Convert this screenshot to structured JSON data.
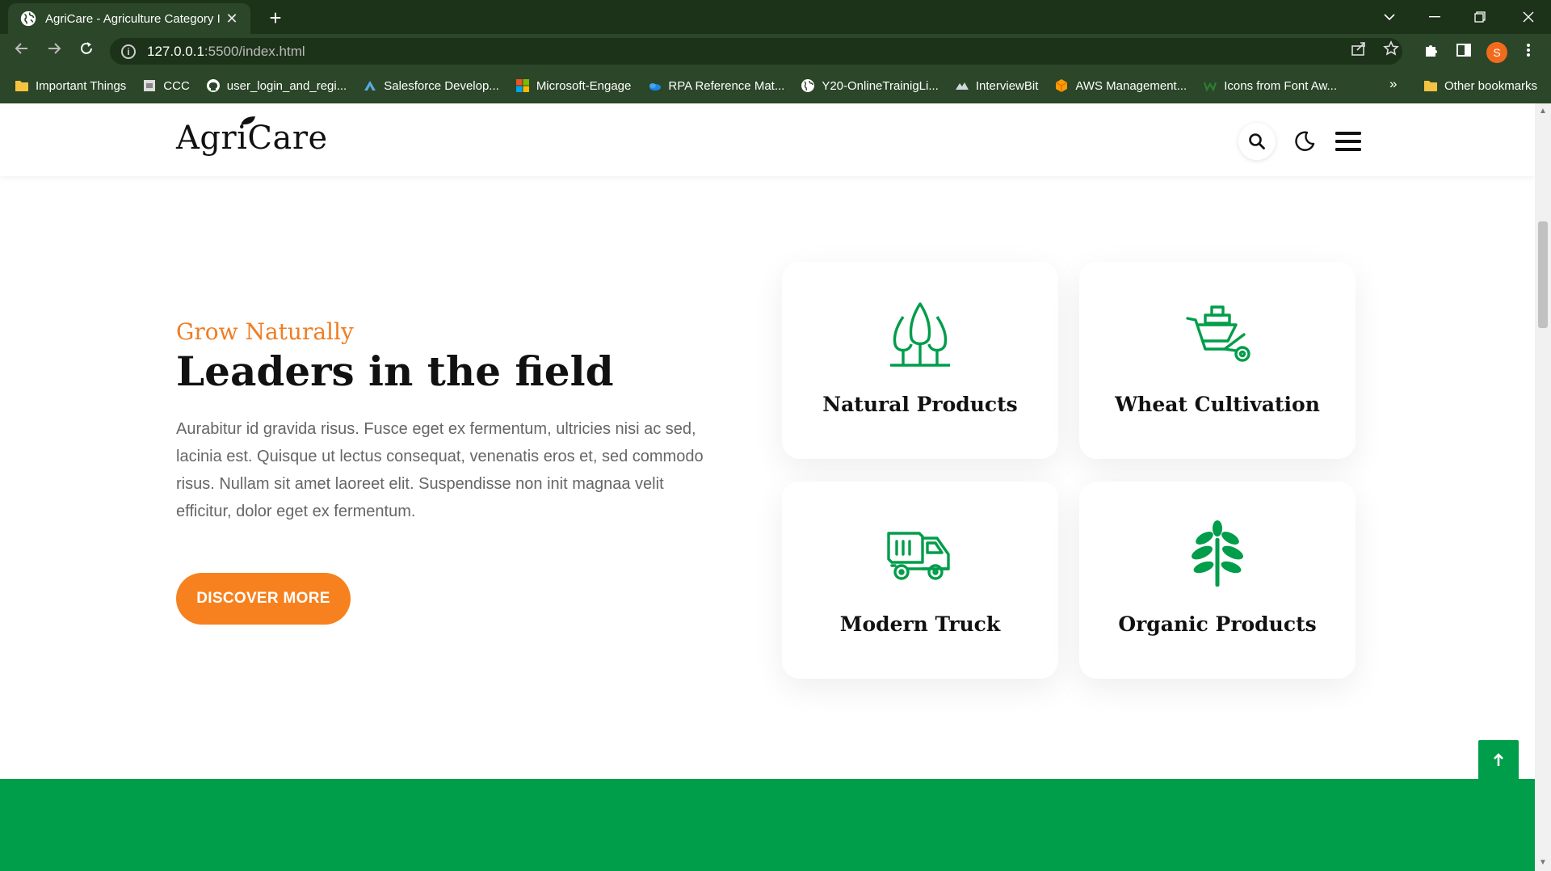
{
  "browser": {
    "tab_title": "AgriCare - Agriculture Category I",
    "tab_close": "✕",
    "new_tab": "+",
    "url_host": "127.0.0.1",
    "url_path": ":5500/index.html",
    "profile_initial": "S",
    "bookmarks": [
      {
        "label": "Important Things",
        "icon": "folder-icon",
        "color": "#f5c242"
      },
      {
        "label": "CCC",
        "icon": "page-icon",
        "color": "#dddddd"
      },
      {
        "label": "user_login_and_regi...",
        "icon": "github-icon",
        "color": "#ffffff"
      },
      {
        "label": "Salesforce Develop...",
        "icon": "salesforce-icon",
        "color": "#5aa9e6"
      },
      {
        "label": "Microsoft-Engage",
        "icon": "microsoft-icon",
        "color": "#f25022"
      },
      {
        "label": "RPA Reference Mat...",
        "icon": "onedrive-icon",
        "color": "#1e88e5"
      },
      {
        "label": "Y20-OnlineTrainigLi...",
        "icon": "globe-icon",
        "color": "#ffffff"
      },
      {
        "label": "InterviewBit",
        "icon": "interviewbit-icon",
        "color": "#cfd8dc"
      },
      {
        "label": "AWS Management...",
        "icon": "aws-icon",
        "color": "#ff9900"
      },
      {
        "label": "Icons from Font Aw...",
        "icon": "fontawesome-icon",
        "color": "#2e7d32"
      }
    ],
    "bookmarks_more": "»",
    "other_bookmarks": "Other bookmarks"
  },
  "site": {
    "logo": "AgriCare",
    "eyebrow": "Grow Naturally",
    "headline": "Leaders in the field",
    "paragraph": "Aurabitur id gravida risus. Fusce eget ex fermentum, ultricies nisi ac sed, lacinia est. Quisque ut lectus consequat, venenatis eros et, sed commodo risus. Nullam sit amet laoreet elit. Suspendisse non init magnaa velit efficitur, dolor eget ex fermentum.",
    "cta": "DISCOVER MORE",
    "cards": [
      {
        "title": "Natural Products",
        "icon": "trees-icon"
      },
      {
        "title": "Wheat Cultivation",
        "icon": "wheelbarrow-icon"
      },
      {
        "title": "Modern Truck",
        "icon": "truck-icon"
      },
      {
        "title": "Organic Products",
        "icon": "plant-icon"
      }
    ]
  },
  "colors": {
    "accent_orange": "#f7811e",
    "brand_green": "#009d4a",
    "chrome_dark": "#1c3219",
    "chrome_mid": "#2b4628"
  }
}
